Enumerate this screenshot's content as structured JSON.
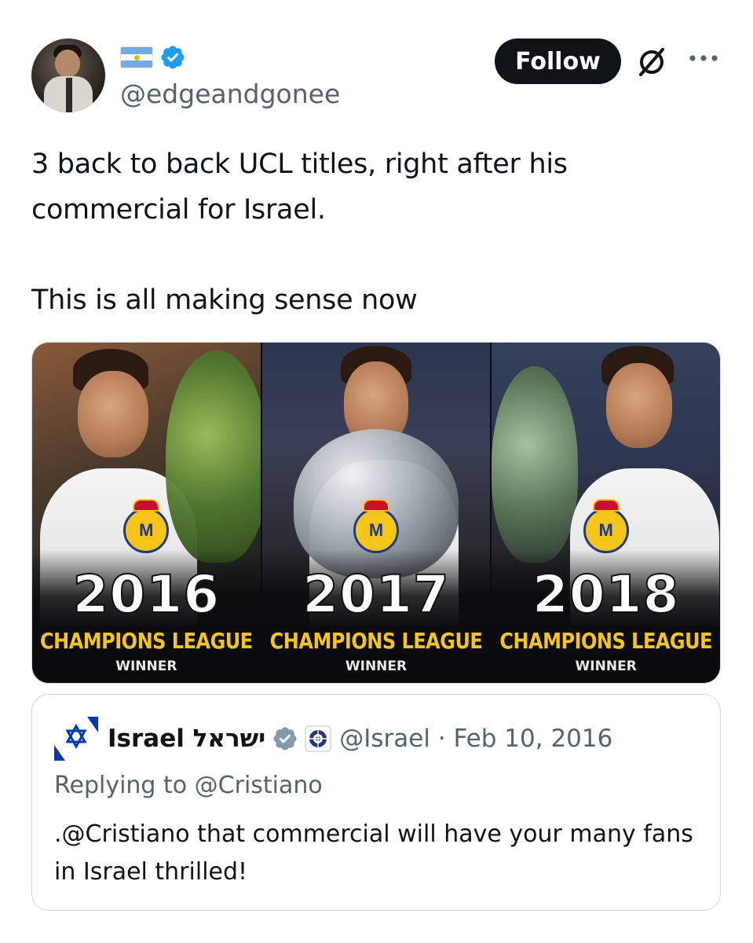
{
  "author": {
    "flag_icon": "argentina-flag-emoji",
    "verified_icon": "verified-badge-icon",
    "handle": "@edgeandgonee",
    "avatar_icon": "user-avatar"
  },
  "actions": {
    "follow_label": "Follow",
    "grok_icon": "grok-icon",
    "more_icon": "more-dots-icon"
  },
  "tweet": {
    "line1": "3 back to back UCL titles, right after his",
    "line2": "commercial for Israel.",
    "line3": "This is all making sense now"
  },
  "media": {
    "panels": [
      {
        "year": "2016",
        "title": "CHAMPIONS LEAGUE",
        "subtitle": "WINNER"
      },
      {
        "year": "2017",
        "title": "CHAMPIONS LEAGUE",
        "subtitle": "WINNER"
      },
      {
        "year": "2018",
        "title": "CHAMPIONS LEAGUE",
        "subtitle": "WINNER"
      }
    ]
  },
  "quoted": {
    "name": "Israel ישראל",
    "handle_date": "@Israel · Feb 10, 2016",
    "replying": "Replying to @Cristiano",
    "text": ".@Cristiano that commercial will have your many fans in Israel thrilled!",
    "verified_icon": "grey-verified-badge-icon",
    "affiliate_icon": "government-emblem-icon"
  },
  "colors": {
    "text_primary": "#0f1419",
    "text_secondary": "#536471",
    "verified_blue": "#1d9bf0",
    "accent_gold": "#f5c518"
  }
}
